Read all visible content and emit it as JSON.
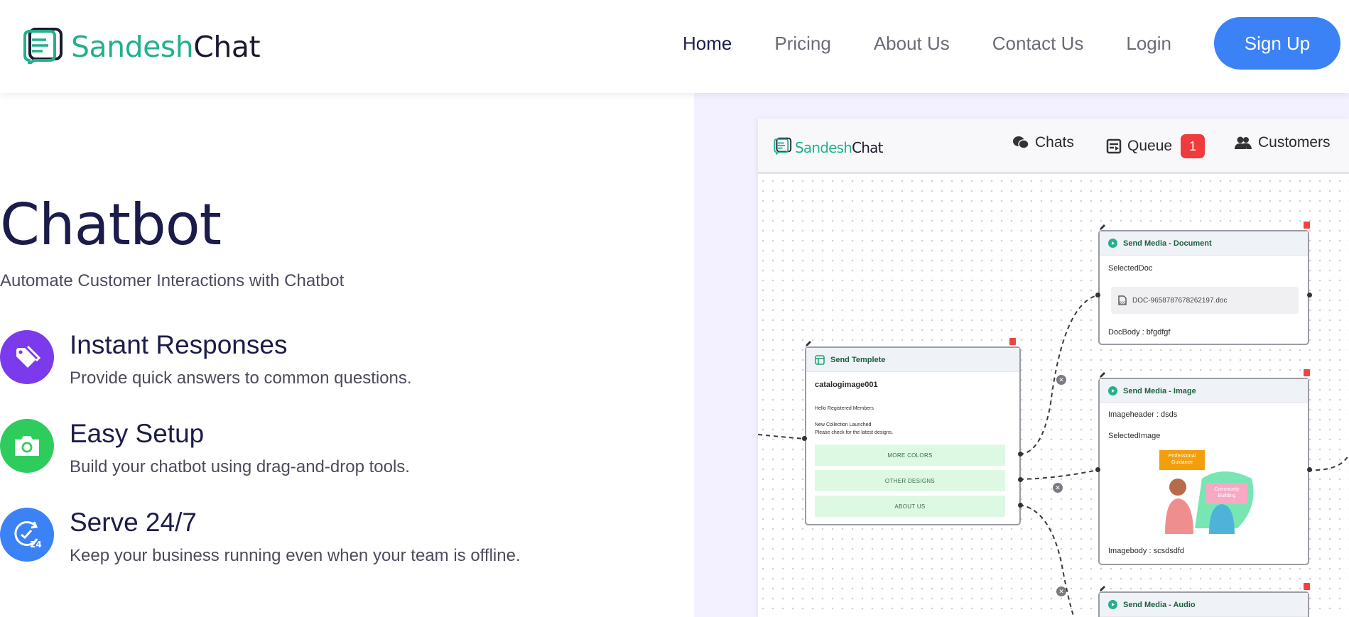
{
  "header": {
    "brand_a": "Sandesh",
    "brand_b": "Chat",
    "nav": {
      "home": "Home",
      "pricing": "Pricing",
      "about": "About Us",
      "contact": "Contact Us",
      "login": "Login"
    },
    "signup_label": "Sign Up"
  },
  "hero": {
    "title": "Chatbot",
    "subtitle": "Automate Customer Interactions with Chatbot",
    "features": [
      {
        "icon": "tag-icon",
        "title": "Instant Responses",
        "desc": "Provide quick answers to common questions."
      },
      {
        "icon": "camera-icon",
        "title": "Easy Setup",
        "desc": "Build your chatbot using drag-and-drop tools."
      },
      {
        "icon": "clock-24-icon",
        "title": "Serve 24/7",
        "desc": "Keep your business running even when your team is offline."
      }
    ]
  },
  "preview": {
    "brand_a": "Sandesh",
    "brand_b": "Chat",
    "nav": {
      "chats": "Chats",
      "queue": "Queue",
      "queue_count": "1",
      "customers": "Customers"
    },
    "template_node": {
      "title": "Send Templete",
      "name": "catalogimage001",
      "line1": "Hello Registered Members",
      "line2": "New Collection Launched",
      "line3": "Please check for the latest designs.",
      "buttons": [
        "MORE COLORS",
        "OTHER DESIGNS",
        "ABOUT US"
      ]
    },
    "doc_node": {
      "title": "Send Media - Document",
      "selected_label": "SelectedDoc",
      "file_name": "DOC-9658787678262197.doc",
      "body": "DocBody : bfgdfgf"
    },
    "image_node": {
      "title": "Send Media - Image",
      "header": "Imageheader : dsds",
      "selected_label": "SelectedImage",
      "tag1": "Professional Guidance",
      "tag2": "Community Building",
      "body": "Imagebody : scsdsdfd"
    },
    "audio_node": {
      "title": "Send Media - Audio"
    }
  },
  "colors": {
    "brand_green": "#22b08e",
    "primary_blue": "#3b82f6",
    "feature_purple": "#7c3aed",
    "feature_green": "#2ecc5c",
    "feature_blue": "#3b82f6",
    "badge_red": "#ef3b3b"
  }
}
